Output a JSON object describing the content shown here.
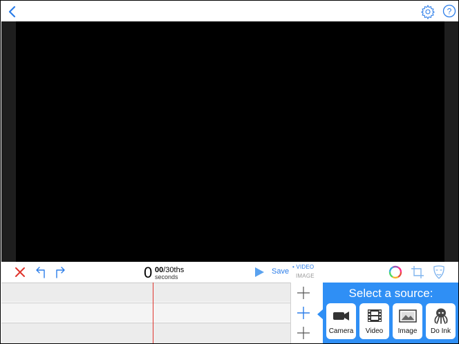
{
  "colors": {
    "accent": "#2b7de9",
    "panel": "#2f8ff5",
    "delete": "#e0342c",
    "playhead": "#e0342c",
    "stage": "#000000"
  },
  "toolbar": {
    "time_value": "0",
    "time_frames": "00",
    "time_fps": "/30ths",
    "time_unit": "seconds",
    "save_label": "Save",
    "mode_video": "• VIDEO",
    "mode_image": "IMAGE"
  },
  "icons": {
    "back": "back-icon",
    "settings": "gear-icon",
    "help": "help-icon",
    "delete": "close-icon",
    "undo": "undo-icon",
    "redo": "redo-icon",
    "play": "play-icon",
    "color": "color-wheel-icon",
    "crop": "crop-icon",
    "mask": "mask-icon"
  },
  "timeline": {
    "tracks": 3
  },
  "source_picker": {
    "title": "Select a source:",
    "options": [
      {
        "label": "Camera",
        "icon": "camera-icon"
      },
      {
        "label": "Video",
        "icon": "film-icon"
      },
      {
        "label": "Image",
        "icon": "image-icon"
      },
      {
        "label": "Do Ink",
        "icon": "octopus-icon"
      }
    ]
  }
}
